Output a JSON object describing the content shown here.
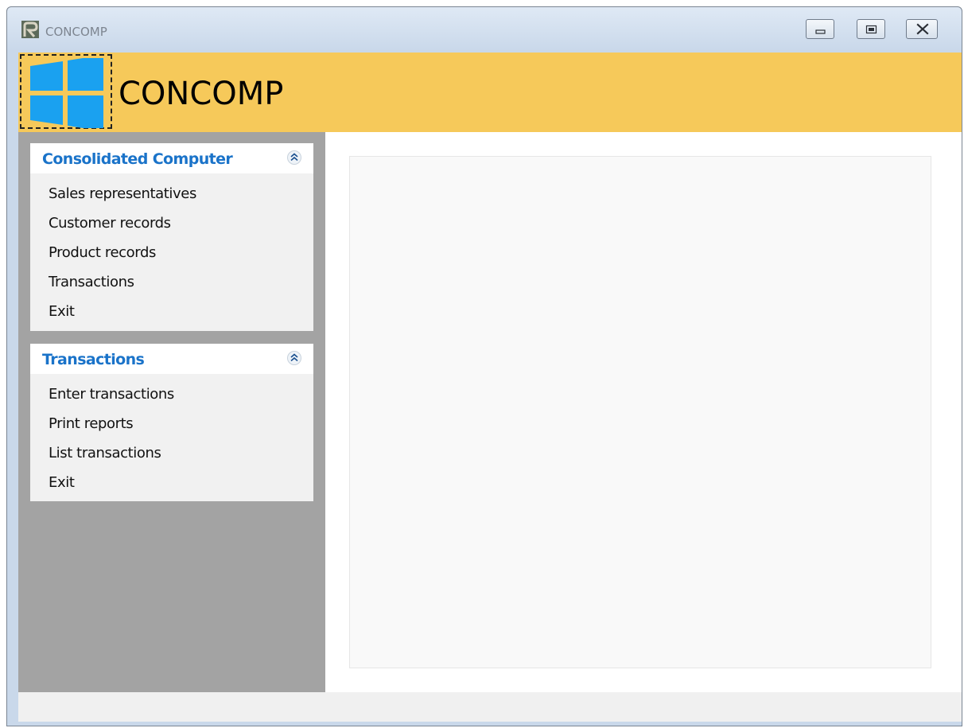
{
  "window": {
    "title": "CONCOMP",
    "icon": "app-icon",
    "controls": {
      "minimize_icon": "minimize-icon",
      "maximize_icon": "maximize-icon",
      "close_icon": "close-icon"
    }
  },
  "header": {
    "title": "CONCOMP",
    "logo_icon": "windows-logo-icon",
    "background_color": "#f6c95a",
    "logo_color": "#1aa1f0"
  },
  "sidebar": {
    "background_color": "#a3a3a3",
    "panels": [
      {
        "title": "Consolidated Computer",
        "collapse_icon": "double-chevron-up-icon",
        "items": [
          {
            "label": "Sales representatives"
          },
          {
            "label": "Customer records"
          },
          {
            "label": "Product records"
          },
          {
            "label": "Transactions"
          },
          {
            "label": "Exit"
          }
        ]
      },
      {
        "title": "Transactions",
        "collapse_icon": "double-chevron-up-icon",
        "items": [
          {
            "label": "Enter transactions"
          },
          {
            "label": "Print reports"
          },
          {
            "label": "List transactions"
          },
          {
            "label": "Exit"
          }
        ]
      }
    ]
  },
  "colors": {
    "panel_title": "#1a73c9",
    "panel_body": "#f1f1f1",
    "content_area": "#f9f9f9"
  }
}
